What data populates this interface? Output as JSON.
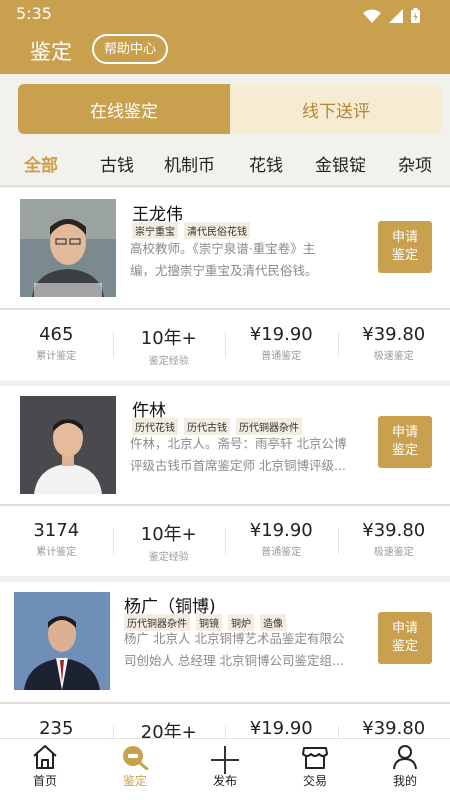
{
  "status": {
    "time": "5:35"
  },
  "header": {
    "title": "鉴定",
    "help_label": "帮助中心"
  },
  "segment": {
    "online": "在线鉴定",
    "offline": "线下送评"
  },
  "categories": [
    "全部",
    "古钱",
    "机制币",
    "花钱",
    "金银锭",
    "杂项"
  ],
  "experts": [
    {
      "name": "王龙伟",
      "tags": [
        "崇宁重宝",
        "清代民俗花钱"
      ],
      "desc_line1": "高校教师。《崇宁泉谱·重宝卷》主",
      "desc_line2": "编，尤擅崇宁重宝及清代民俗钱。",
      "apply_line1": "申请",
      "apply_line2": "鉴定",
      "stats": [
        {
          "value": "465",
          "label": "累计鉴定"
        },
        {
          "value": "10年+",
          "label": "鉴定经验"
        },
        {
          "value": "¥19.90",
          "label": "普通鉴定"
        },
        {
          "value": "¥39.80",
          "label": "极速鉴定"
        }
      ]
    },
    {
      "name": "仵林",
      "tags": [
        "历代花钱",
        "历代古钱",
        "历代铜器杂件"
      ],
      "desc_line1": "仵林，北京人。斋号：雨亭轩 北京公博",
      "desc_line2": "评级古钱币首席鉴定师 北京铜博评级...",
      "apply_line1": "申请",
      "apply_line2": "鉴定",
      "stats": [
        {
          "value": "3174",
          "label": "累计鉴定"
        },
        {
          "value": "10年+",
          "label": "鉴定经验"
        },
        {
          "value": "¥19.90",
          "label": "普通鉴定"
        },
        {
          "value": "¥39.80",
          "label": "极速鉴定"
        }
      ]
    },
    {
      "name": "杨广（铜博)",
      "tags": [
        "历代铜器杂件",
        "铜镜",
        "铜炉",
        "造像"
      ],
      "desc_line1": "杨广 北京人 北京铜博艺术品鉴定有限公",
      "desc_line2": "司创始人 总经理 北京铜博公司鉴定组...",
      "apply_line1": "申请",
      "apply_line2": "鉴定",
      "stats": [
        {
          "value": "235",
          "label": ""
        },
        {
          "value": "20年+",
          "label": ""
        },
        {
          "value": "¥19.90",
          "label": ""
        },
        {
          "value": "¥39.80",
          "label": ""
        }
      ]
    }
  ],
  "nav": [
    {
      "label": "首页",
      "icon": "home-icon"
    },
    {
      "label": "鉴定",
      "icon": "appraisal-icon"
    },
    {
      "label": "发布",
      "icon": "plus-icon"
    },
    {
      "label": "交易",
      "icon": "shop-icon"
    },
    {
      "label": "我的",
      "icon": "person-icon"
    }
  ],
  "colors": {
    "accent": "#c9a04e",
    "accent_light": "#f6ecd3",
    "background": "#f3f1ee"
  }
}
